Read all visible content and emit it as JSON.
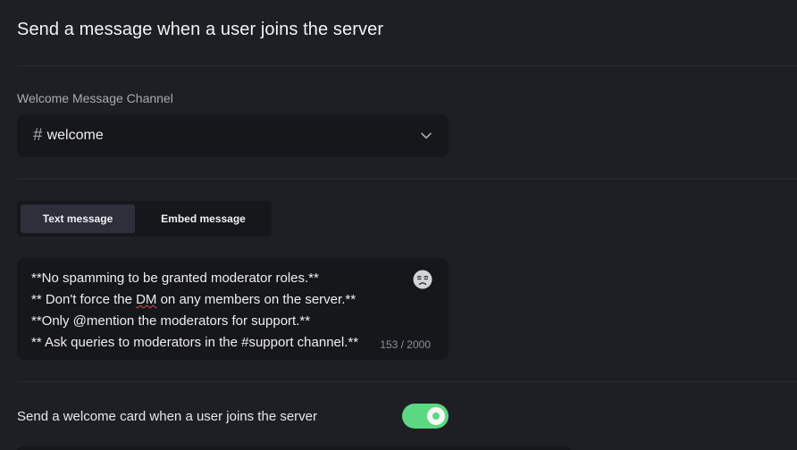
{
  "section": {
    "title": "Send a message when a user joins the server"
  },
  "channel": {
    "label": "Welcome Message Channel",
    "hash_icon": "#",
    "value": "welcome",
    "dropdown_icon": "chevron-down-icon"
  },
  "message_type": {
    "tabs": [
      {
        "label": "Text message",
        "active": true
      },
      {
        "label": "Embed message",
        "active": false
      }
    ]
  },
  "message": {
    "lines": [
      "**No spamming to be granted moderator roles.**",
      "** Don't force the ",
      "DM",
      " on any members on the server.**",
      "**Only @mention the moderators for support.**",
      "** Ask queries to moderators in the #support channel.**"
    ],
    "counter": "153 / 2000",
    "emoji_icon": "emoji-picker-icon"
  },
  "welcome_card": {
    "label": "Send a welcome card when a user joins the server",
    "enabled": true,
    "accent": "#5bd881"
  }
}
